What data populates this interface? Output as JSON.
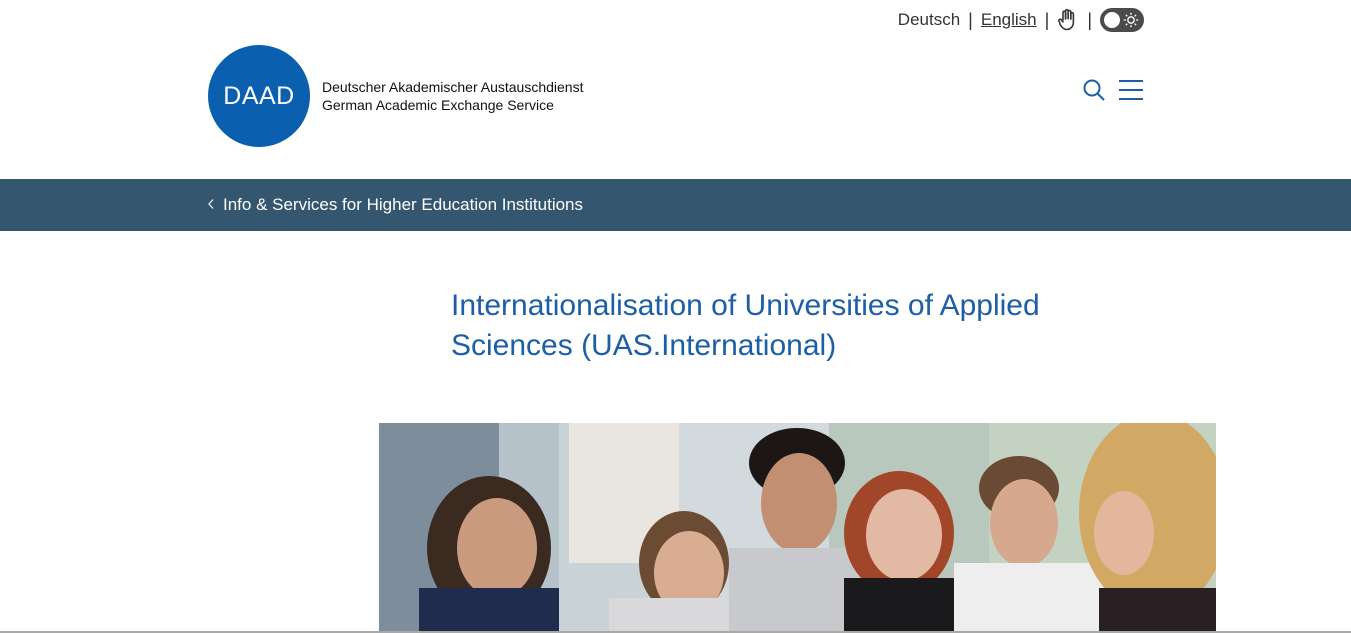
{
  "languages": {
    "de": "Deutsch",
    "en": "English",
    "separator": "|"
  },
  "accessibility": {
    "easy_language_icon": "hand-icon",
    "contrast_toggle_icon": "sun-icon"
  },
  "logo": {
    "acronym": "DAAD",
    "line1": "Deutscher Akademischer Austauschdienst",
    "line2": "German Academic Exchange Service"
  },
  "header_icons": [
    "search-icon",
    "menu-icon"
  ],
  "breadcrumb": {
    "label": "Info & Services for Higher Education Institutions",
    "icon": "chevron-left-icon"
  },
  "page": {
    "title": "Internationalisation of Universities of Applied Sciences (UAS.International)"
  },
  "colors": {
    "brand_blue": "#0a5fae",
    "band": "#34576f",
    "title": "#1c5fa6"
  }
}
